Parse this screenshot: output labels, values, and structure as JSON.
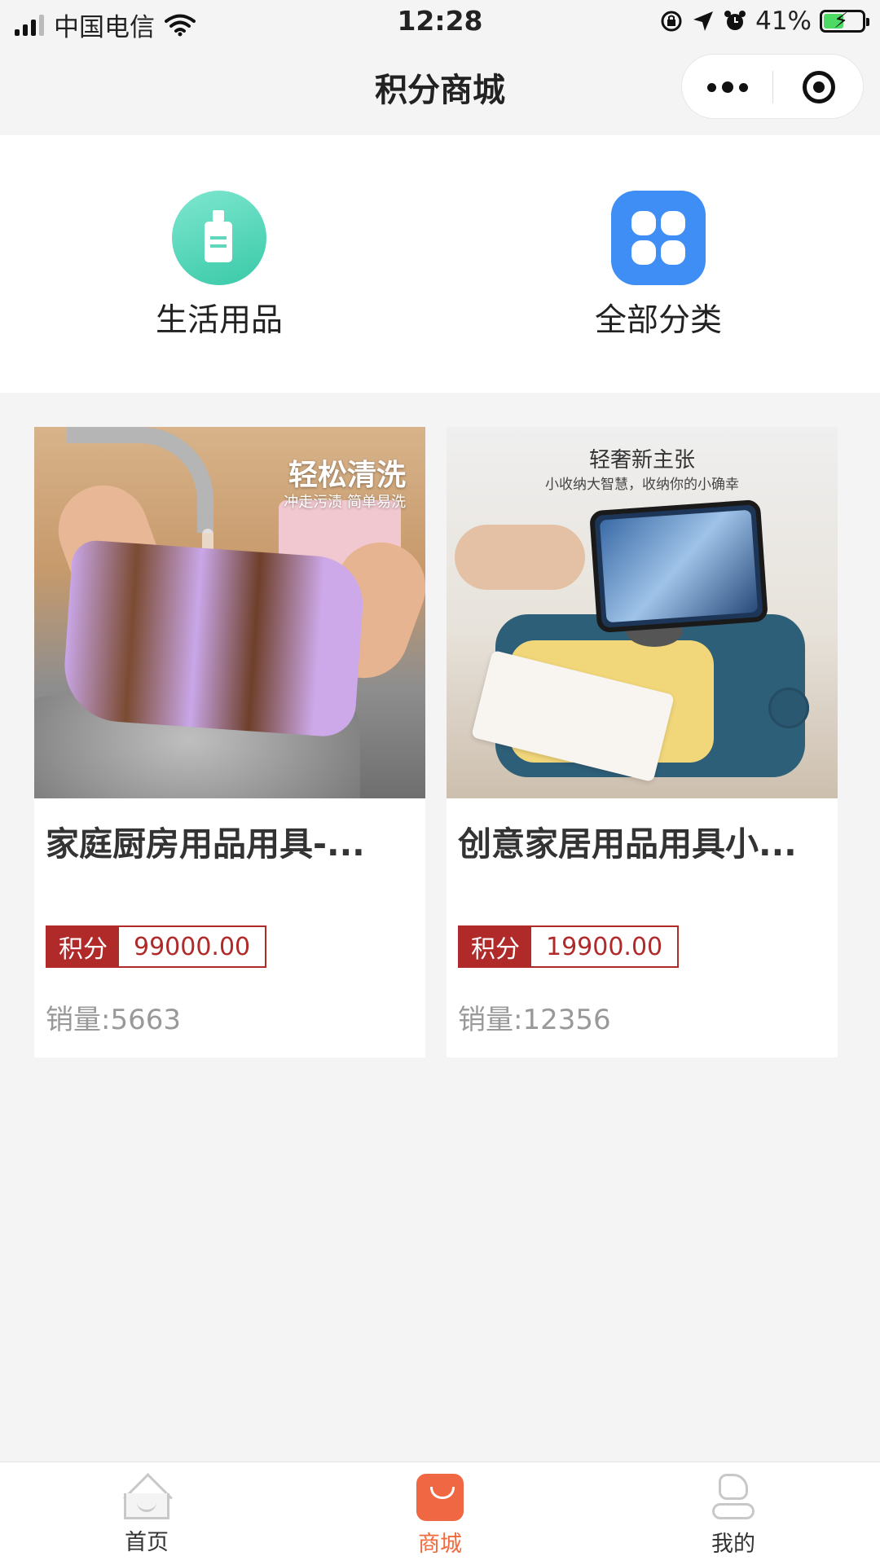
{
  "status_bar": {
    "carrier": "中国电信",
    "time": "12:28",
    "battery": "41%",
    "icons": [
      "signal-icon",
      "wifi-icon",
      "orientation-lock-icon",
      "location-icon",
      "alarm-icon",
      "battery-icon"
    ]
  },
  "nav": {
    "title": "积分商城",
    "icons": [
      "more-icon",
      "close-icon"
    ]
  },
  "categories": [
    {
      "label": "生活用品",
      "icon": "daily-goods-icon",
      "color": "#39c9a8"
    },
    {
      "label": "全部分类",
      "icon": "all-categories-icon",
      "color": "#3f8ef5"
    }
  ],
  "products": [
    {
      "name": "家庭厨房用品用具-...",
      "price_label": "积分",
      "price": "99000.00",
      "sales": "销量:5663",
      "image_text_title": "轻松清洗",
      "image_text_sub": "冲走污渍 简单易洗"
    },
    {
      "name": "创意家居用品用具小...",
      "price_label": "积分",
      "price": "19900.00",
      "sales": "销量:12356",
      "image_text_title": "轻奢新主张",
      "image_text_sub": "小收纳大智慧，收纳你的小确幸"
    }
  ],
  "tabs": [
    {
      "label": "首页",
      "icon": "home-icon",
      "active": false
    },
    {
      "label": "商城",
      "icon": "mall-bag-icon",
      "active": true
    },
    {
      "label": "我的",
      "icon": "profile-icon",
      "active": false
    }
  ],
  "colors": {
    "accent": "#ef6a3d",
    "price_red": "#b02a2a",
    "background": "#f4f4f4"
  }
}
